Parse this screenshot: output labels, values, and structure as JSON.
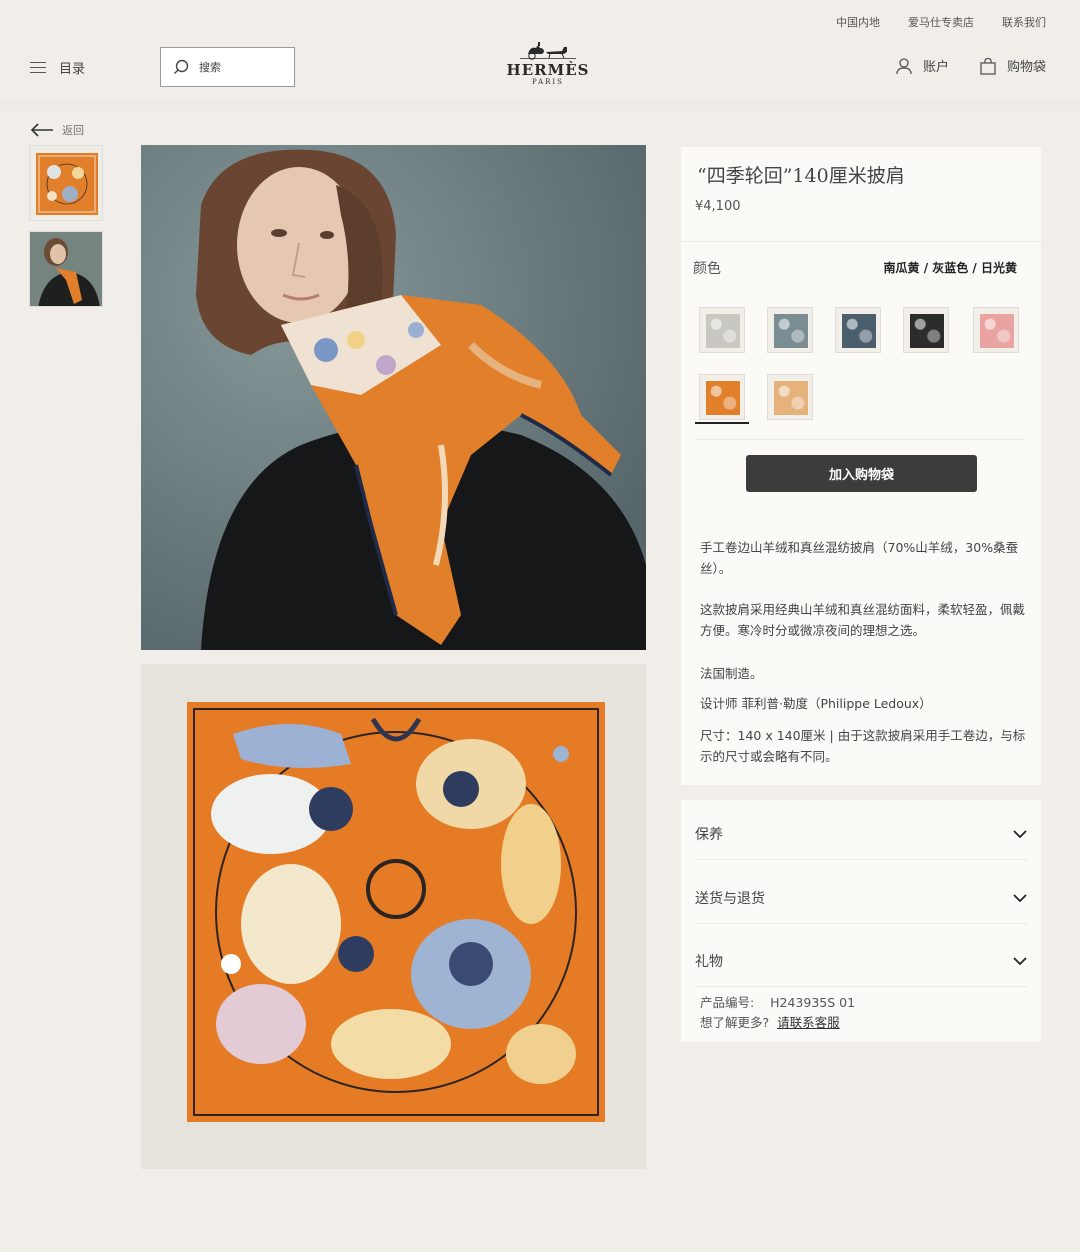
{
  "utility_nav": [
    "中国内地",
    "爱马仕专卖店",
    "联系我们"
  ],
  "header": {
    "menu_label": "目录",
    "search_placeholder": "搜索",
    "brand": "HERMÈS",
    "brand_sub": "PARIS",
    "account_label": "账户",
    "bag_label": "购物袋"
  },
  "back_label": "返回",
  "product": {
    "title": "“四季轮回”140厘米披肩",
    "price": "¥4,100",
    "color_label": "颜色",
    "color_value": "南瓜黄 / 灰蓝色 / 日光黄",
    "swatch_colors": [
      "#c9c7c2",
      "#7a8d92",
      "#4b5e6e",
      "#2c2c2c",
      "#e9a3a0",
      "#e27f2b",
      "#e5b27c"
    ],
    "selected_swatch": 5,
    "add_to_bag": "加入购物袋",
    "description": [
      "手工卷边山羊绒和真丝混纺披肩（70%山羊绒，30%桑蚕丝）。",
      "这款披肩采用经典山羊绒和真丝混纺面料，柔软轻盈，佩戴方便。寒冷时分或微凉夜间的理想之选。",
      "法国制造。",
      "设计师 菲利普·勒度（Philippe Ledoux）",
      "尺寸：140 x 140厘米 | 由于这款披肩采用手工卷边，与标示的尺寸或会略有不同。"
    ]
  },
  "accordion": [
    "保养",
    "送货与退货",
    "礼物"
  ],
  "meta": {
    "sku_label": "产品编号:",
    "sku": "H243935S 01",
    "help_text": "想了解更多?",
    "help_link": "请联系客服"
  },
  "colors": {
    "background": "#f1eee9",
    "panel": "#fbfaf7",
    "button": "#3c3c3c",
    "scarf_orange": "#e27f2b"
  }
}
